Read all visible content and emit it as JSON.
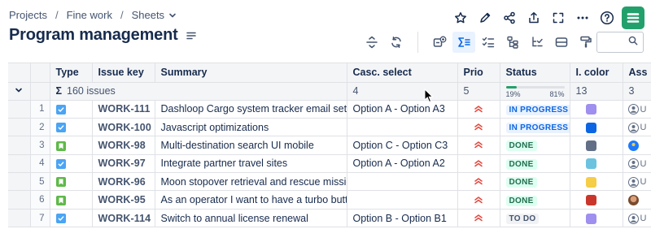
{
  "breadcrumb": {
    "items": [
      "Projects",
      "Fine work",
      "Sheets"
    ],
    "separator": "/"
  },
  "page_title": "Program management",
  "top_actions": [
    "star-icon",
    "pencil-icon",
    "share-icon",
    "export-icon",
    "fullscreen-icon",
    "more-icon",
    "help-icon"
  ],
  "toolbar": {
    "icons": [
      "collapse-rows-icon",
      "refresh-icon",
      "add-structure-icon",
      "sum-icon",
      "checklist-icon",
      "hierarchy-icon",
      "hierarchy-filter-icon",
      "row-height-icon",
      "paint-format-icon"
    ],
    "active": "sum-icon"
  },
  "search": {
    "placeholder": ""
  },
  "columns": [
    "Type",
    "Issue key",
    "Summary",
    "Casc. select",
    "Prio",
    "Status",
    "I. color",
    "Ass"
  ],
  "summary_row": {
    "sigma": "Σ",
    "issues": "160 issues",
    "casc": "4",
    "prio": "5",
    "status_left": "19%",
    "status_right": "81%",
    "status_progress": 0.19,
    "icolor": "13",
    "assignee": "3"
  },
  "rows": [
    {
      "num": "1",
      "type": "task",
      "key": "WORK-111",
      "summary": "Dashloop Cargo system tracker email setup",
      "casc": "Option A - Option A3",
      "status": "IN PROGRESS",
      "status_kind": "inprogress",
      "color": "#9f8fef",
      "avatar": "user",
      "assignee_letter": "U"
    },
    {
      "num": "2",
      "type": "task",
      "key": "WORK-100",
      "summary": "Javascript optimizations",
      "casc": "",
      "status": "IN PROGRESS",
      "status_kind": "inprogress",
      "color": "#0c66e4",
      "avatar": "user",
      "assignee_letter": "U"
    },
    {
      "num": "3",
      "type": "story",
      "key": "WORK-98",
      "summary": "Multi-destination search UI mobile",
      "casc": "Option C - Option C3",
      "status": "DONE",
      "status_kind": "done",
      "color": "#626f86",
      "avatar": "blue",
      "assignee_letter": ""
    },
    {
      "num": "4",
      "type": "task",
      "key": "WORK-97",
      "summary": "Integrate partner travel sites",
      "casc": "Option A - Option A2",
      "status": "DONE",
      "status_kind": "done",
      "color": "#6cc3e0",
      "avatar": "user",
      "assignee_letter": "U"
    },
    {
      "num": "5",
      "type": "story",
      "key": "WORK-96",
      "summary": "Moon stopover retrieval and rescue mission…",
      "casc": "",
      "status": "DONE",
      "status_kind": "done",
      "color": "#f5cd47",
      "avatar": "user",
      "assignee_letter": "U"
    },
    {
      "num": "6",
      "type": "story",
      "key": "WORK-95",
      "summary": "As an operator I want to have a turbo button",
      "casc": "",
      "status": "DONE",
      "status_kind": "done",
      "color": "#c9372c",
      "avatar": "photo",
      "assignee_letter": ""
    },
    {
      "num": "7",
      "type": "task",
      "key": "WORK-114",
      "summary": "Switch to annual license renewal",
      "casc": "Option B - Option B1",
      "status": "TO DO",
      "status_kind": "todo",
      "color": "#9f8fef",
      "avatar": "user",
      "assignee_letter": "U"
    }
  ],
  "priority_icon": "priority-high-icon",
  "colors": {
    "accent": "#0c66e4",
    "logo": "#22a06b"
  }
}
